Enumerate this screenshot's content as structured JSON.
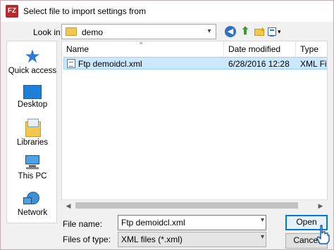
{
  "window": {
    "title": "Select file to import settings from",
    "app_icon_text": "FZ"
  },
  "toolbar": {
    "lookin_label": "Look in:",
    "lookin_value": "demo",
    "icons": [
      "back-icon",
      "up-folder-icon",
      "new-folder-icon",
      "view-menu-icon"
    ]
  },
  "places": [
    {
      "label": "Quick access",
      "icon": "star-icon"
    },
    {
      "label": "Desktop",
      "icon": "desktop-icon"
    },
    {
      "label": "Libraries",
      "icon": "libraries-icon"
    },
    {
      "label": "This PC",
      "icon": "computer-icon"
    },
    {
      "label": "Network",
      "icon": "network-icon"
    }
  ],
  "filelist": {
    "columns": [
      "Name",
      "Date modified",
      "Type"
    ],
    "rows": [
      {
        "name": "Ftp demoidcl.xml",
        "date": "6/28/2016 12:28",
        "type": "XML File",
        "selected": true
      }
    ]
  },
  "form": {
    "file_name_label": "File name:",
    "file_name_value": "Ftp demoidcl.xml",
    "file_type_label": "Files of type:",
    "file_type_value": "XML files (*.xml)"
  },
  "buttons": {
    "open": "Open",
    "cancel": "Cancel"
  },
  "colors": {
    "selection": "#cce8ff",
    "accent": "#0078d7"
  }
}
